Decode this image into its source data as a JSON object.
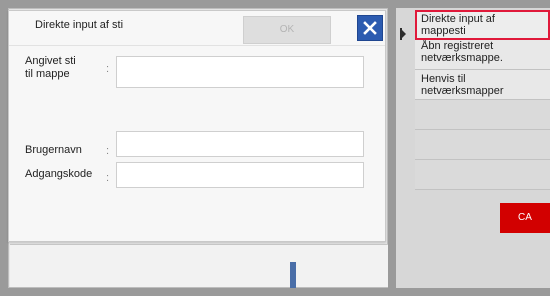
{
  "dialog": {
    "title": "Direkte input af sti",
    "ok_label": "OK",
    "close_icon": "close-icon"
  },
  "form": {
    "path_label_line1": "Angivet sti",
    "path_label_line2": "til mappe",
    "path_value": "",
    "username_label": "Brugernavn",
    "username_value": "",
    "password_label": "Adgangskode",
    "password_value": "",
    "colon": ":"
  },
  "right_panel": {
    "items": [
      {
        "label_line1": "Direkte input af",
        "label_line2": "mappesti",
        "selected": true
      },
      {
        "label_line1": "Åbn registreret",
        "label_line2": "netværksmappe.",
        "selected": false
      },
      {
        "label_line1": "Henvis til",
        "label_line2": "netværksmapper",
        "selected": false
      }
    ],
    "ca_label": "CA"
  },
  "colors": {
    "accent_blue": "#2c5bb0",
    "selection_red": "#e0193a",
    "ca_red": "#d20000"
  }
}
